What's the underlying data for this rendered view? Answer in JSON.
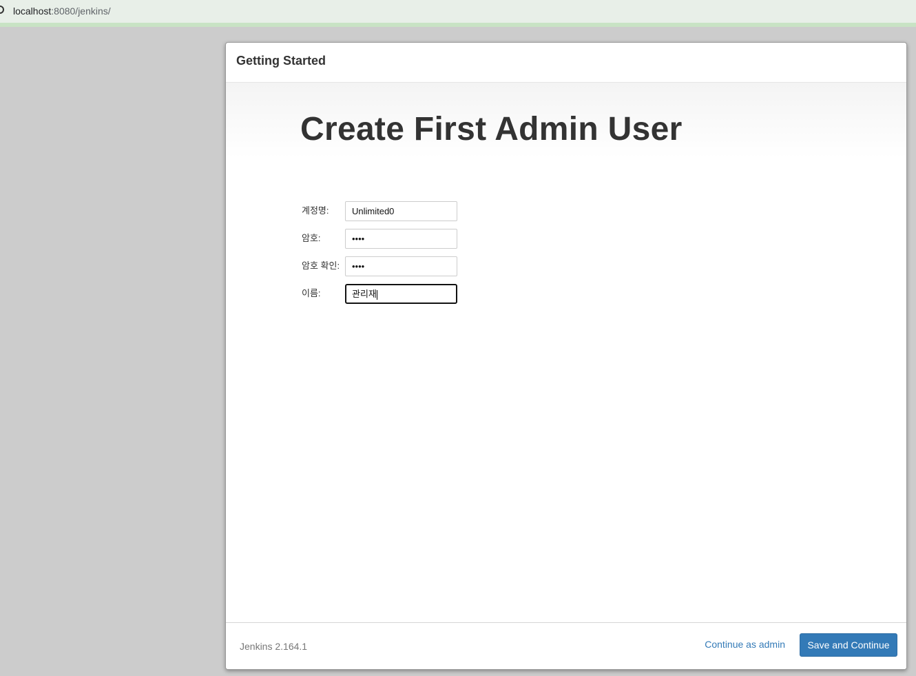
{
  "browser": {
    "url_host": "localhost",
    "url_rest": ":8080/jenkins/"
  },
  "dialog": {
    "title": "Getting Started",
    "heading": "Create First Admin User"
  },
  "form": {
    "fields": [
      {
        "label": "계정명:",
        "value": "Unlimited0"
      },
      {
        "label": "암호:",
        "value": "••••"
      },
      {
        "label": "암호 확인:",
        "value": "••••"
      },
      {
        "label": "이름:",
        "value": "관리재"
      }
    ]
  },
  "footer": {
    "version": "Jenkins 2.164.1",
    "continue_label": "Continue as admin",
    "save_label": "Save and Continue"
  },
  "colors": {
    "primary": "#337ab7",
    "background": "#cccccc"
  }
}
